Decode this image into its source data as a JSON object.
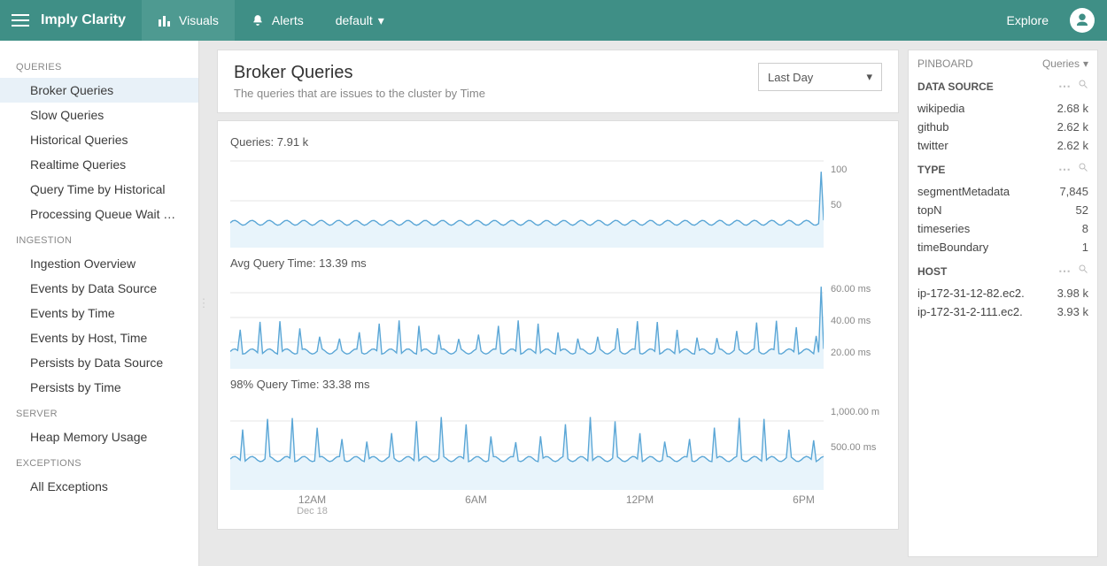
{
  "topbar": {
    "brand": "Imply Clarity",
    "visuals": "Visuals",
    "alerts": "Alerts",
    "tenant": "default",
    "explore": "Explore"
  },
  "sidebar": {
    "groups": [
      {
        "label": "QUERIES",
        "items": [
          "Broker Queries",
          "Slow Queries",
          "Historical Queries",
          "Realtime Queries",
          "Query Time by Historical",
          "Processing Queue Wait Time"
        ],
        "activeIndex": 0
      },
      {
        "label": "INGESTION",
        "items": [
          "Ingestion Overview",
          "Events by Data Source",
          "Events by Time",
          "Events by Host, Time",
          "Persists by Data Source",
          "Persists by Time"
        ]
      },
      {
        "label": "SERVER",
        "items": [
          "Heap Memory Usage"
        ]
      },
      {
        "label": "EXCEPTIONS",
        "items": [
          "All Exceptions"
        ]
      }
    ]
  },
  "header": {
    "title": "Broker Queries",
    "subtitle": "The queries that are issues to the cluster by Time",
    "range": "Last Day"
  },
  "chart_data": [
    {
      "type": "area",
      "title": "Queries: 7.91 k",
      "y_ticks": [
        "100",
        "50"
      ],
      "ylim": [
        0,
        110
      ],
      "series": [
        {
          "name": "queries",
          "values_estimated": {
            "baseline": 28,
            "oscillation_amplitude": 3,
            "oscillation_count": 58,
            "spike_end_value": 90
          }
        }
      ],
      "note": "Roughly constant ~28 with small sawtooth; single large spike at far right to ~90."
    },
    {
      "type": "line",
      "title": "Avg Query Time: 13.39 ms",
      "y_ticks": [
        "60.00 ms",
        "40.00 ms",
        "20.00 ms"
      ],
      "ylim": [
        0,
        70
      ],
      "series": [
        {
          "name": "avg_query_time_ms",
          "values_estimated": {
            "baseline": 12,
            "periodic_peaks": 30,
            "peak_height_range": [
              22,
              46
            ],
            "final_spike": 62
          }
        }
      ],
      "note": "Baseline ~12ms with ~hourly narrow peaks 22-46ms; final spike ~62ms at right edge."
    },
    {
      "type": "line",
      "title": "98% Query Time: 33.38 ms",
      "y_ticks": [
        "1,000.00 m",
        "500.00 ms"
      ],
      "ylim": [
        0,
        1400
      ],
      "series": [
        {
          "name": "p98_query_time_ms",
          "values_estimated": {
            "baseline": 450,
            "periodic_peaks": 24,
            "peak_height_range": [
              900,
              1250
            ]
          }
        }
      ],
      "note": "Baseline ~450ms with regular tall narrow peaks ~900-1250ms across the day."
    }
  ],
  "xaxis": {
    "ticks": [
      "12AM",
      "6AM",
      "12PM",
      "6PM"
    ],
    "sub": "Dec 18"
  },
  "pinboard": {
    "title": "PINBOARD",
    "measure": "Queries",
    "sections": [
      {
        "label": "DATA SOURCE",
        "rows": [
          {
            "k": "wikipedia",
            "v": "2.68 k"
          },
          {
            "k": "github",
            "v": "2.62 k"
          },
          {
            "k": "twitter",
            "v": "2.62 k"
          }
        ]
      },
      {
        "label": "TYPE",
        "rows": [
          {
            "k": "segmentMetadata",
            "v": "7,845"
          },
          {
            "k": "topN",
            "v": "52"
          },
          {
            "k": "timeseries",
            "v": "8"
          },
          {
            "k": "timeBoundary",
            "v": "1"
          }
        ]
      },
      {
        "label": "HOST",
        "rows": [
          {
            "k": "ip-172-31-12-82.ec2.",
            "v": "3.98 k"
          },
          {
            "k": "ip-172-31-2-111.ec2.",
            "v": "3.93 k"
          }
        ]
      }
    ]
  }
}
